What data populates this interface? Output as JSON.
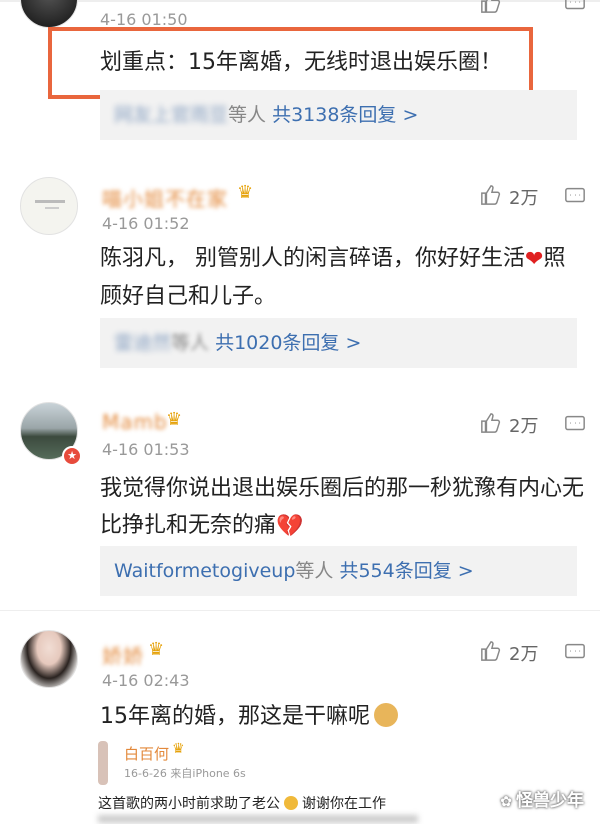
{
  "comment0": {
    "time": "4-16 01:50",
    "content": "划重点：15年离婚，无线时退出娱乐圈！",
    "reply_names": "网友上官雨豆",
    "reply_suffix": "等人",
    "reply_count": "共3138条回复 >"
  },
  "comment1": {
    "username": "喵小姐不在家",
    "time": "4-16 01:52",
    "likes": "2万",
    "content_line1": "陈羽凡， 别管别人的闲言碎语，你好好生活",
    "content_line2": "顾好自己和儿子。",
    "heart_after": "照",
    "reply_names": "雷迪然",
    "reply_suffix": "等人",
    "reply_count": "共1020条回复 >"
  },
  "comment2": {
    "username": "Mamb",
    "time": "4-16 01:53",
    "likes": "2万",
    "content_line1": "我觉得你说出退出娱乐圈后的那一秒犹豫有内心无",
    "content_line2": "比挣扎和无奈的痛",
    "reply_names": "Waitformetogiveup",
    "reply_suffix": "等人",
    "reply_count": "共554条回复 >"
  },
  "comment3": {
    "username": "娇娇",
    "time": "4-16 02:43",
    "likes": "2万",
    "content": "15年离的婚，那这是干嘛呢"
  },
  "quote": {
    "username": "白百何",
    "meta": "16-6-26 来自iPhone 6s",
    "text": "这首歌的两小时前求助了老公",
    "text2": "谢谢你在工作"
  },
  "watermark": "怪兽少年",
  "colors": {
    "accent": "#e9663d",
    "link": "#3d6fb0",
    "username": "#e3893b"
  }
}
